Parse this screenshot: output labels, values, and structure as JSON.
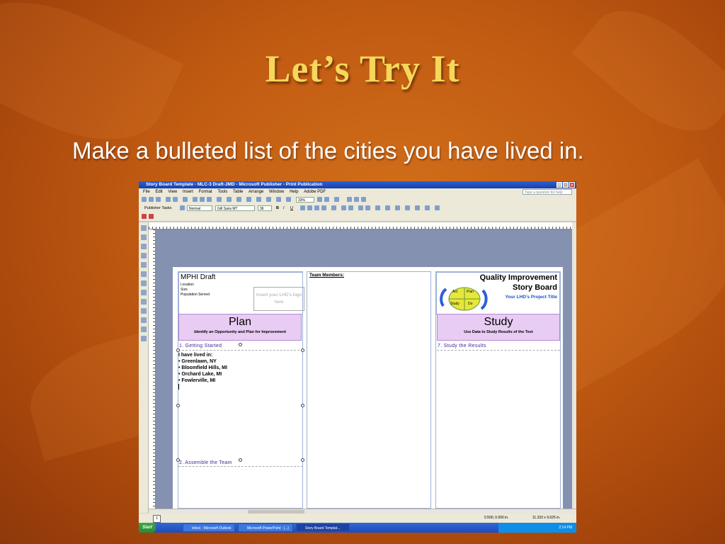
{
  "slide": {
    "title": "Let’s Try It",
    "subtitle": "Make a bulleted list of the cities you have lived in."
  },
  "window": {
    "title": "Story Board Template - MLC-3 Draft-JMD - Microsoft Publisher - Print Publication",
    "menu": [
      "File",
      "Edit",
      "View",
      "Insert",
      "Format",
      "Tools",
      "Table",
      "Arrange",
      "Window",
      "Help",
      "Adobe PDF"
    ],
    "help_placeholder": "Type a question for help",
    "zoom": "33%",
    "tasks_label": "Publisher Tasks",
    "style_value": "Normal",
    "font_value": "Gill Sans MT",
    "size_value": "36"
  },
  "document": {
    "draft_title": "MPHI Draft",
    "fields": [
      "Location",
      "Size",
      "Population Served"
    ],
    "logo_text": "Insert your LHD’s logo here",
    "team_label": "Team Members:",
    "qi_title": "Quality Improvement",
    "qi_subtitle": "Story Board",
    "project_title": "Your LHD’s Project Title",
    "cycle": [
      "Act",
      "Plan",
      "Study",
      "Do"
    ],
    "plan_title": "Plan",
    "plan_sub": "Identify an Opportunity and Plan for Improvement",
    "study_title": "Study",
    "study_sub": "Use Data to Study Results of the Test",
    "section1": "1.  Getting Started",
    "section2": "2.  Assemble the Team",
    "section7": "7.  Study the Results",
    "body_lines": [
      "I have lived in:",
      "• Greenlawn, NY",
      "• Bloomfield Hills, MI",
      "• Orchard Lake, MI",
      "• Fowlerville, MI"
    ]
  },
  "statusbar": {
    "page": "1",
    "position": "0.500, 0.000 in.",
    "size": "11.333 x  9.625 in."
  },
  "taskbar": {
    "start": "Start",
    "items": [
      "Inbox - Microsoft Outlook",
      "Microsoft PowerPoint - [...]",
      "Story Board Templat..."
    ],
    "clock": "2:14 PM"
  }
}
